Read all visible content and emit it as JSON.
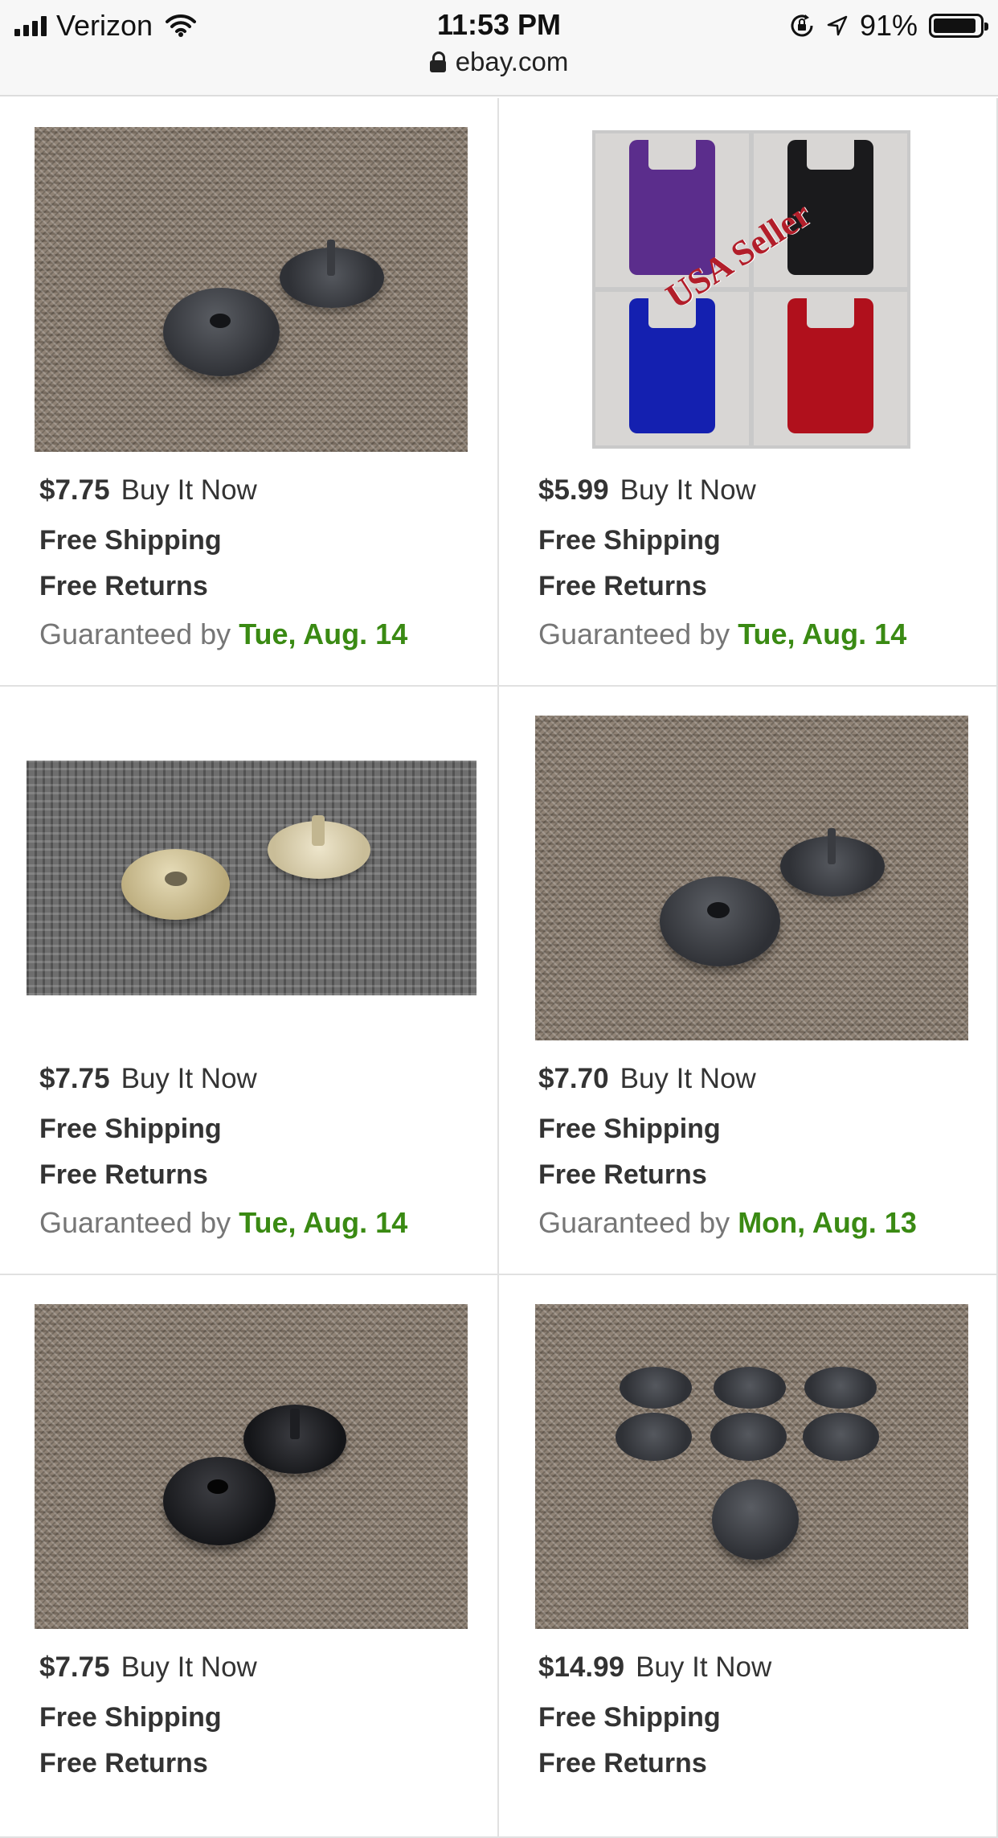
{
  "status_bar": {
    "carrier": "Verizon",
    "time": "11:53 PM",
    "battery_percent": "91%",
    "battery_level": 0.91,
    "url": "ebay.com"
  },
  "colors": {
    "price_text": "#333333",
    "guarantee_date": "#3a8a13",
    "divider": "#e1e1e1"
  },
  "listings": [
    {
      "price": "$7.75",
      "format": "Buy It Now",
      "shipping": "Free Shipping",
      "returns": "Free Returns",
      "guarantee_prefix": "Guaranteed by",
      "guarantee_date": "Tue, Aug. 14"
    },
    {
      "price": "$5.99",
      "format": "Buy It Now",
      "shipping": "Free Shipping",
      "returns": "Free Returns",
      "guarantee_prefix": "Guaranteed by",
      "guarantee_date": "Tue, Aug. 14",
      "image_text": "USA Seller"
    },
    {
      "price": "$7.75",
      "format": "Buy It Now",
      "shipping": "Free Shipping",
      "returns": "Free Returns",
      "guarantee_prefix": "Guaranteed by",
      "guarantee_date": "Tue, Aug. 14"
    },
    {
      "price": "$7.70",
      "format": "Buy It Now",
      "shipping": "Free Shipping",
      "returns": "Free Returns",
      "guarantee_prefix": "Guaranteed by",
      "guarantee_date": "Mon, Aug. 13"
    },
    {
      "price": "$7.75",
      "format": "Buy It Now",
      "shipping": "Free Shipping",
      "returns": "Free Returns"
    },
    {
      "price": "$14.99",
      "format": "Buy It Now",
      "shipping": "Free Shipping",
      "returns": "Free Returns"
    }
  ]
}
